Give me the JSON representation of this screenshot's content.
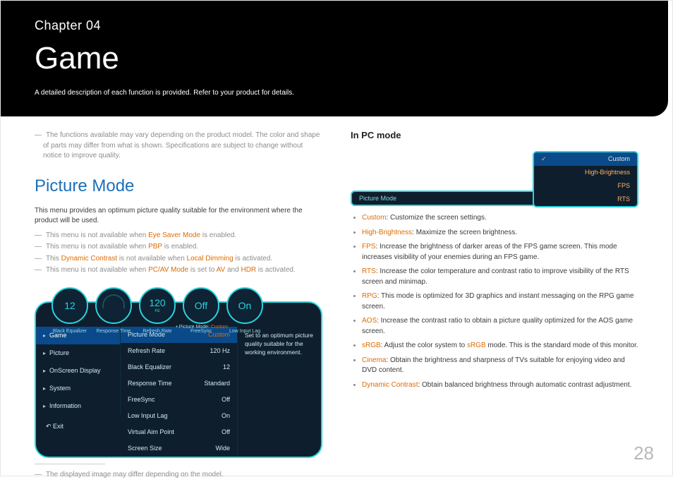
{
  "header": {
    "chapter": "Chapter 04",
    "title": "Game",
    "subtitle": "A detailed description of each function is provided. Refer to your product for details."
  },
  "page_number": "28",
  "left": {
    "top_note": "The functions available may vary depending on the product model. The color and shape of parts may differ from what is shown. Specifications are subject to change without notice to improve quality.",
    "section_title": "Picture Mode",
    "intro": "This menu provides an optimum picture quality suitable for the environment where the product will be used.",
    "notes": [
      {
        "pre": "This menu is not available when ",
        "hl": "Eye Saver Mode",
        "post": " is enabled."
      },
      {
        "pre": "This menu is not available when ",
        "hl": "PBP",
        "post": " is enabled."
      },
      {
        "pre": "This ",
        "hl": "Dynamic Contrast",
        "mid": " is not available when ",
        "hl2": "Local Dimming",
        "post": " is activated."
      },
      {
        "pre": "This menu is not available when ",
        "hl": "PC/AV Mode",
        "mid": " is set to ",
        "hl2": "AV",
        "mid2": " and ",
        "hl3": "HDR",
        "post": " is activated."
      }
    ],
    "dials": [
      {
        "big": "12",
        "sm": "",
        "label": "Black Equalizer"
      },
      {
        "big": "",
        "sm": "gauge",
        "label": "Response Time"
      },
      {
        "big": "120",
        "sm": "Hz",
        "label": "Refresh Rate"
      },
      {
        "big": "Off",
        "sm": "",
        "label": "FreeSync"
      },
      {
        "big": "On",
        "sm": "",
        "label": "Low Input Lag"
      }
    ],
    "crumb_label": "Picture Mode:",
    "crumb_value": "Custom",
    "nav": [
      "Game",
      "Picture",
      "OnScreen Display",
      "System",
      "Information"
    ],
    "exit": "Exit",
    "settings": [
      {
        "k": "Picture Mode",
        "v": "Custom",
        "sel": true,
        "vorange": true
      },
      {
        "k": "Refresh Rate",
        "v": "120 Hz"
      },
      {
        "k": "Black Equalizer",
        "v": "12"
      },
      {
        "k": "Response Time",
        "v": "Standard"
      },
      {
        "k": "FreeSync",
        "v": "Off"
      },
      {
        "k": "Low Input Lag",
        "v": "On"
      },
      {
        "k": "Virtual Aim Point",
        "v": "Off"
      },
      {
        "k": "Screen Size",
        "v": "Wide"
      }
    ],
    "desc": "Set to an optimum picture quality suitable for the working environment.",
    "caption": "The displayed image may differ depending on the model."
  },
  "right": {
    "title": "In PC mode",
    "bar_label": "Picture Mode",
    "options": [
      "Custom",
      "High-Brightness",
      "FPS",
      "RTS"
    ],
    "bullets": [
      {
        "term": "Custom",
        "text": ": Customize the screen settings."
      },
      {
        "term": "High-Brightness",
        "text": ": Maximize the screen brightness."
      },
      {
        "term": "FPS",
        "text": ": Increase the brightness of darker areas of the FPS game screen. This mode increases visibility of your enemies during an FPS game."
      },
      {
        "term": "RTS",
        "text": ": Increase the color temperature and contrast ratio to improve visibility of the RTS screen and minimap."
      },
      {
        "term": "RPG",
        "text": ": This mode is optimized for 3D graphics and instant messaging on the RPG game screen."
      },
      {
        "term": "AOS",
        "text": ": Increase the contrast ratio to obtain a picture quality optimized for the AOS game screen."
      },
      {
        "term": "sRGB",
        "pre": ": Adjust the color system to ",
        "mid_term": "sRGB",
        "text": " mode. This is the standard mode of this monitor."
      },
      {
        "term": "Cinema",
        "text": ": Obtain the brightness and sharpness of TVs suitable for enjoying video and DVD content."
      },
      {
        "term": "Dynamic Contrast",
        "text": ": Obtain balanced brightness through automatic contrast adjustment."
      }
    ]
  }
}
